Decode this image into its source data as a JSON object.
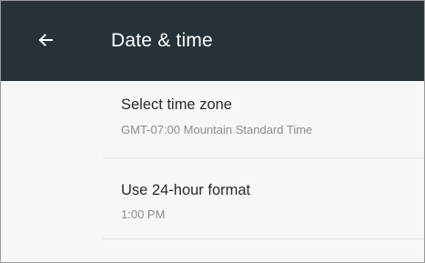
{
  "header": {
    "title": "Date & time",
    "back_icon": "arrow-back-icon"
  },
  "settings": [
    {
      "title": "Select time zone",
      "summary": "GMT-07:00 Mountain Standard Time"
    },
    {
      "title": "Use 24-hour format",
      "summary": "1:00 PM"
    }
  ],
  "colors": {
    "app_bar": "#263238",
    "background": "#f7f7f7",
    "title_text": "#ffffff",
    "primary_text": "#2a2a2a",
    "secondary_text": "#8c8c8c"
  }
}
